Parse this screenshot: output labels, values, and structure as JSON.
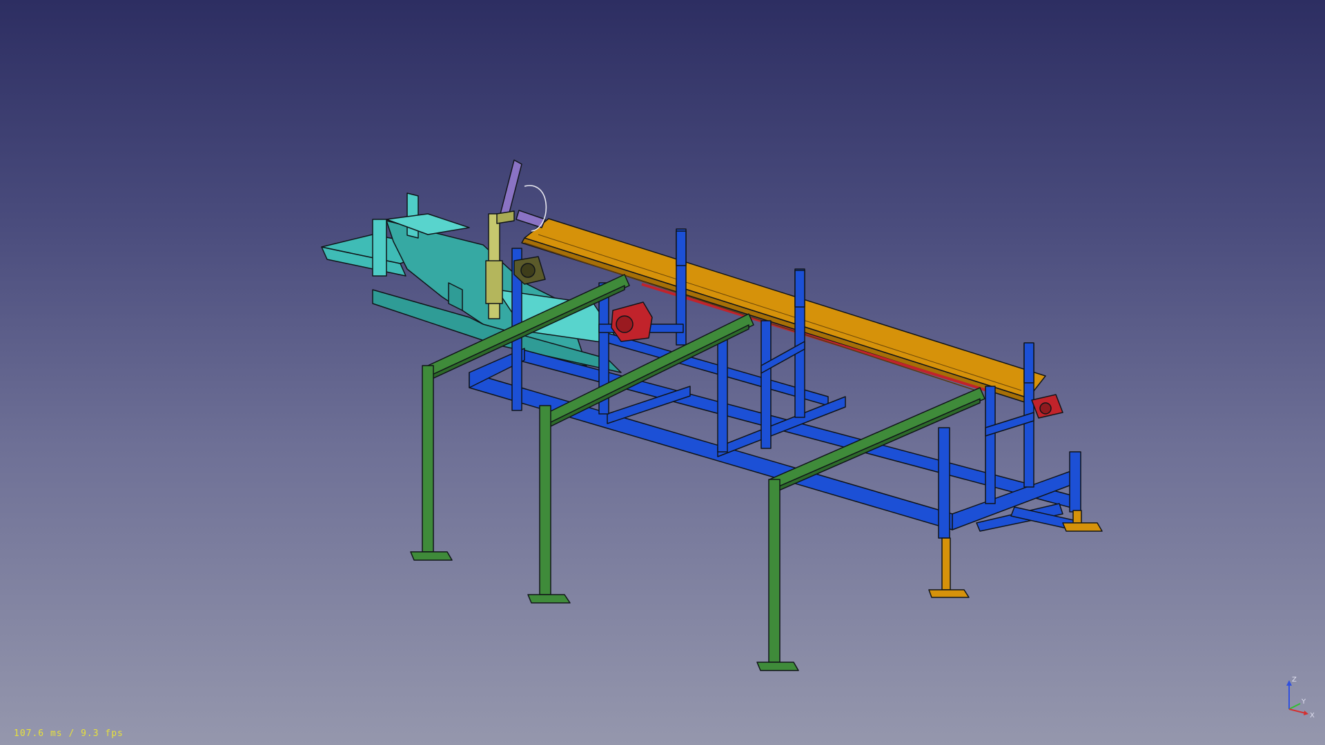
{
  "status": {
    "render_stats": "107.6 ms / 9.3 fps"
  },
  "axes": {
    "z_label": "Z",
    "y_label": "Y",
    "x_label": "X"
  },
  "colors": {
    "background_top": "#2d2e62",
    "background_bottom": "#9597ad",
    "frame_blue": "#1c50d6",
    "support_green": "#3f8b3a",
    "rail_orange": "#d6920a",
    "hopper_teal": "#3fbcb6",
    "motor_red": "#c1232b",
    "arm_purple": "#8a73c4",
    "cylinder_yellow": "#c6c86e",
    "stats_text": "#e8e23a",
    "axis_x": "#d43030",
    "axis_y": "#30c030",
    "axis_z": "#3050e0"
  }
}
